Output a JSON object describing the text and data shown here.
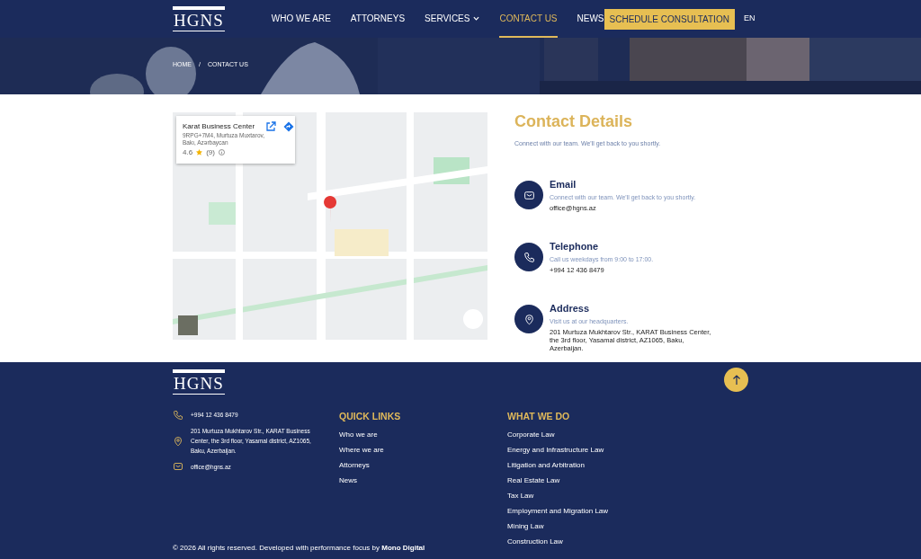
{
  "header": {
    "logo": "HGNS",
    "nav": [
      {
        "label": "WHO WE ARE",
        "selected": false,
        "dropdown": false
      },
      {
        "label": "ATTORNEYS",
        "selected": false,
        "dropdown": false
      },
      {
        "label": "SERVICES",
        "selected": false,
        "dropdown": true
      },
      {
        "label": "CONTACT US",
        "selected": true,
        "dropdown": false
      },
      {
        "label": "NEWS",
        "selected": false,
        "dropdown": false
      }
    ],
    "cta": "SCHEDULE CONSULTATION",
    "language": "EN"
  },
  "hero": {
    "kind": "picture",
    "breadcrumb": [
      "HOME",
      "CONTACT US"
    ],
    "separator": "/"
  },
  "map": {
    "kind": "picture",
    "place_card": {
      "title": "Karat Business Center",
      "address": "9RPG+7M4, Murtuza Muxtarov, Bakı, Azərbaycan",
      "rating": "4.6",
      "reviews": "(9)"
    }
  },
  "contact": {
    "title": "Contact Details",
    "subtitle": "Connect with our team. We'll get back to you shortly.",
    "items": [
      {
        "kind": "email",
        "title": "Email",
        "note": "Connect with our team. We'll get back to you shortly.",
        "value": "office@hgns.az"
      },
      {
        "kind": "phone",
        "title": "Telephone",
        "note": "Call us weekdays from 9:00 to 17:00.",
        "value": "+994 12 436 8479"
      },
      {
        "kind": "address",
        "title": "Address",
        "note": "Visit us at our headquarters.",
        "value": "201 Murtuza Mukhtarov Str., KARAT Business Center, the 3rd floor, Yasamal district, AZ1065, Baku, Azerbaijan."
      }
    ]
  },
  "footer": {
    "logo": "HGNS",
    "contacts": [
      {
        "kind": "phone",
        "text": "+994 12 436 8479"
      },
      {
        "kind": "address",
        "text": "201 Murtuza Mukhtarov Str., KARAT Business Center, the 3rd floor, Yasamal district, AZ1065, Baku, Azerbaijan."
      },
      {
        "kind": "email",
        "text": "office@hgns.az"
      }
    ],
    "quick_links": {
      "title": "QUICK LINKS",
      "links": [
        "Who we are",
        "Where we are",
        "Attorneys",
        "News"
      ]
    },
    "services": {
      "title": "WHAT WE DO",
      "links": [
        "Corporate Law",
        "Energy and Infrastructure Law",
        "Litigation and Arbitration",
        "Real Estate Law",
        "Tax Law",
        "Employment and Migration Law",
        "Mining Law",
        "Construction Law"
      ]
    },
    "copyright": "© 2026 All rights reserved. Developed with performance focus by **Mono Digital**"
  }
}
